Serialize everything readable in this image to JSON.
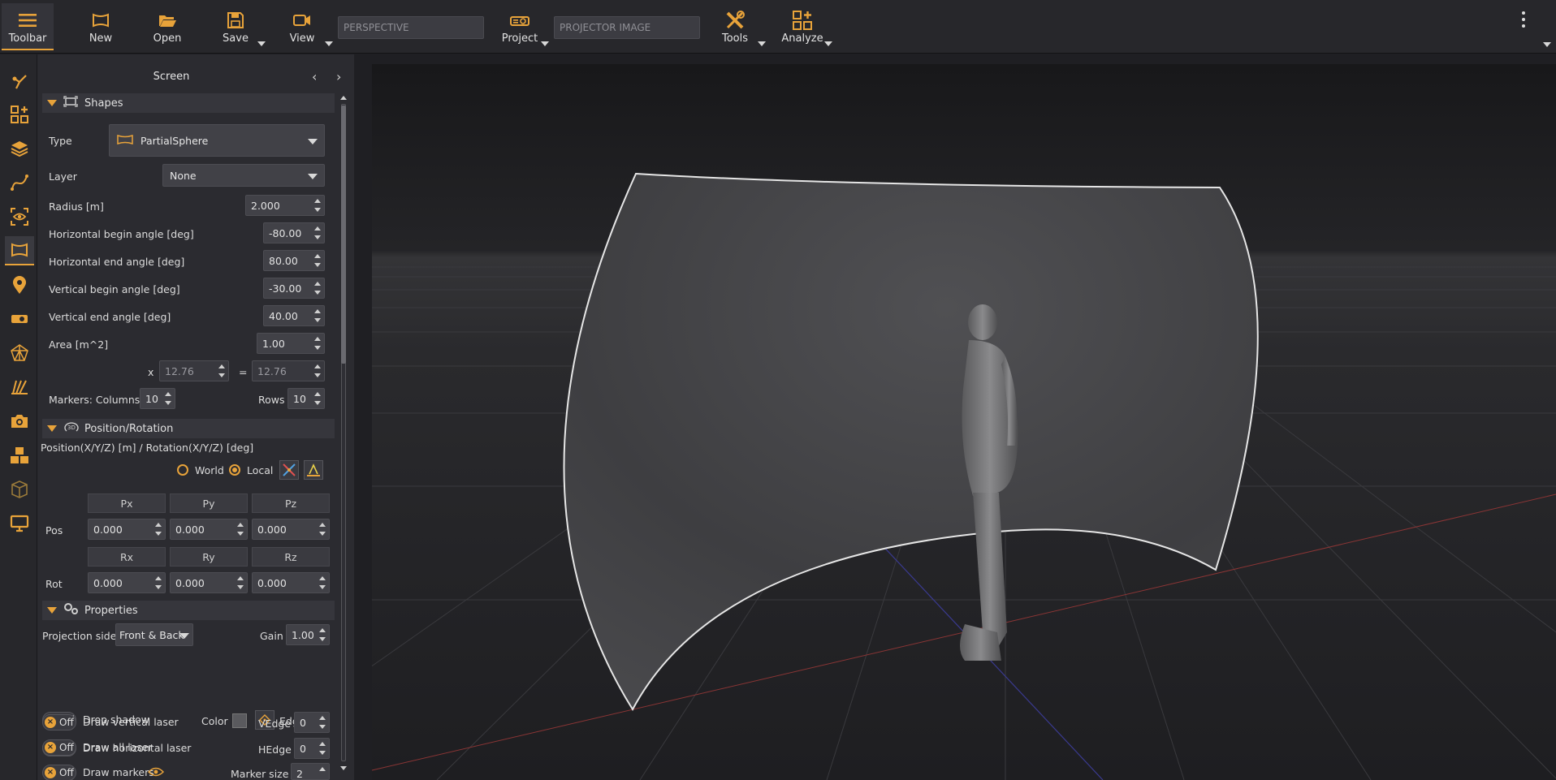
{
  "toolbar": {
    "items": [
      {
        "label": "Toolbar",
        "icon": "hamburger-menu-icon"
      },
      {
        "label": "New",
        "icon": "new-screen-icon"
      },
      {
        "label": "Open",
        "icon": "folder-open-icon"
      },
      {
        "label": "Save",
        "icon": "floppy-disk-icon"
      },
      {
        "label": "View",
        "icon": "video-camera-icon"
      },
      {
        "label": "Project",
        "icon": "projector-icon"
      },
      {
        "label": "Tools",
        "icon": "tools-icon"
      },
      {
        "label": "Analyze",
        "icon": "analyze-icon"
      }
    ],
    "perspective_field": "PERSPECTIVE",
    "projector_image_field": "PROJECTOR IMAGE"
  },
  "panel": {
    "title": "Screen",
    "shapes": {
      "section_label": "Shapes",
      "type_label": "Type",
      "type_value": "PartialSphere",
      "layer_label": "Layer",
      "layer_value": "None",
      "radius_label": "Radius  [m]",
      "radius_value": "2.000",
      "h_begin_label": "Horizontal begin angle [deg]",
      "h_begin_value": "-80.00",
      "h_end_label": "Horizontal end angle [deg]",
      "h_end_value": "80.00",
      "v_begin_label": "Vertical begin angle [deg]",
      "v_begin_value": "-30.00",
      "v_end_label": "Vertical end angle [deg]",
      "v_end_value": "40.00",
      "area_label": "Area  [m^2]",
      "area_value": "1.00",
      "x_label": "x",
      "area_x_value": "12.76",
      "eq_label": "=",
      "area_eq_value": "12.76",
      "markers_label": "Markers:  Columns",
      "columns_value": "10",
      "rows_label": "Rows",
      "rows_value": "10"
    },
    "position": {
      "section_label": "Position/Rotation",
      "subtitle": "Position(X/Y/Z) [m] / Rotation(X/Y/Z) [deg]",
      "world_label": "World",
      "local_label": "Local",
      "px": "Px",
      "py": "Py",
      "pz": "Pz",
      "pos_label": "Pos",
      "pos_x": "0.000",
      "pos_y": "0.000",
      "pos_z": "0.000",
      "rx": "Rx",
      "ry": "Ry",
      "rz": "Rz",
      "rot_label": "Rot",
      "rot_x": "0.000",
      "rot_y": "0.000",
      "rot_z": "0.000"
    },
    "properties": {
      "section_label": "Properties",
      "projection_side_label": "Projection side",
      "projection_side_value": "Front & Back",
      "gain_label": "Gain",
      "gain_value": "1.00",
      "off": "Off",
      "drop_shadow": "Drop shadow",
      "color_label": "Color",
      "edge_label": "Edge",
      "draw_h_laser": "Draw horizontal laser",
      "hedge_label": "HEdge",
      "hedge_value": "0",
      "draw_v_laser": "Draw vertical laser",
      "vedge_label": "VEdge",
      "vedge_value": "0",
      "draw_all_laser": "Draw all laser",
      "draw_markers": "Draw markers",
      "marker_size_label": "Marker size",
      "marker_size_value": "2"
    }
  },
  "colors": {
    "accent": "#e8a33a",
    "background": "#1f1f23",
    "panel": "#2b2b30"
  }
}
